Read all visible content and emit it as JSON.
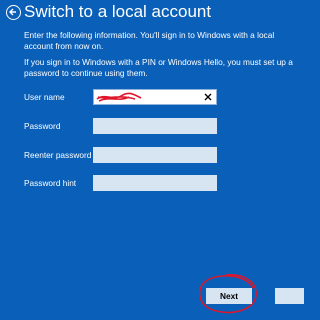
{
  "header": {
    "title": "Switch to a local account"
  },
  "intro": {
    "line1": "Enter the following information. You'll sign in to Windows with a local account from now on.",
    "line2": "If you sign in to Windows with a PIN or Windows Hello, you must set up a password to continue using them."
  },
  "form": {
    "username_label": "User name",
    "password_label": "Password",
    "reenter_label": "Reenter password",
    "hint_label": "Password hint"
  },
  "footer": {
    "next_label": "Next"
  },
  "colors": {
    "background": "#0a5fb8",
    "field_fill": "#d7e4f2",
    "annotation": "#e0162b"
  },
  "icons": {
    "back": "back-arrow-icon",
    "clear": "close-icon"
  }
}
